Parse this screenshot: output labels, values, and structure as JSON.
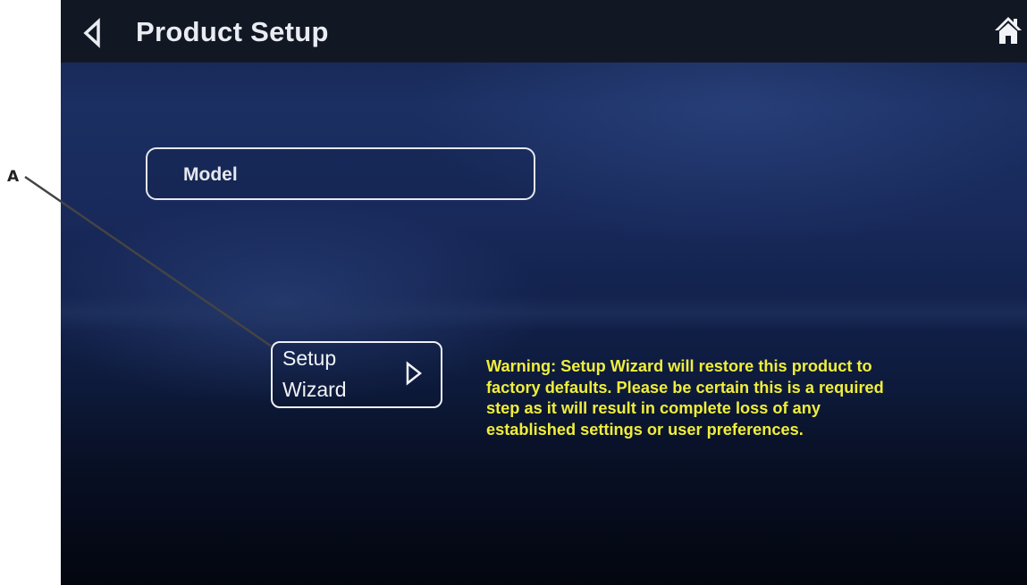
{
  "callout": {
    "label": "A"
  },
  "header": {
    "title": "Product Setup",
    "back_icon": "chevron-left-icon",
    "home_icon": "home-icon"
  },
  "main": {
    "model_button": {
      "label": "Model"
    },
    "setup_wizard_button": {
      "label_line1": "Setup",
      "label_line2": "Wizard",
      "icon": "chevron-right-icon"
    },
    "warning_text": "Warning: Setup Wizard will restore this product to factory defaults. Please be certain this is a required step as it will result in complete loss of any established settings or user preferences."
  },
  "colors": {
    "topbar": "#121823",
    "warning_text": "#f0ee3a",
    "button_border": "#e6e8ee"
  }
}
